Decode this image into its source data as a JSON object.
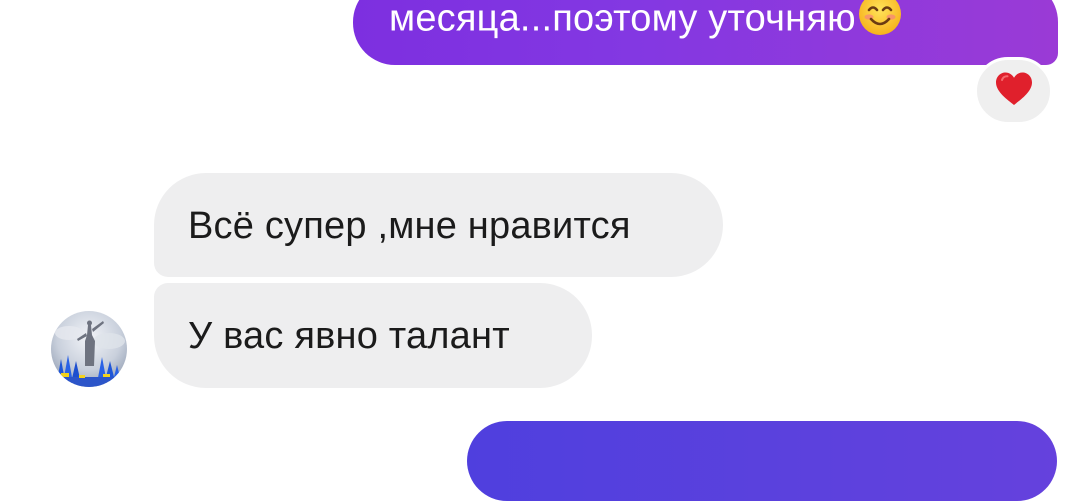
{
  "chat": {
    "messages": [
      {
        "direction": "outgoing",
        "text": "месяца...поэтому уточняю",
        "emoji": "smiling-face-icon",
        "reaction": "red-heart-icon"
      },
      {
        "direction": "incoming",
        "text": "Всё супер ,мне нравится"
      },
      {
        "direction": "incoming",
        "text": "У вас явно талант",
        "avatar": "contact-avatar"
      },
      {
        "direction": "outgoing",
        "text": ""
      }
    ]
  },
  "colors": {
    "outgoing_top": "#8338e2",
    "outgoing_bottom": "#5a41dd",
    "incoming_bg": "#eeeeef",
    "heart": "#e0202c",
    "emoji_face": "#ffcc33"
  }
}
